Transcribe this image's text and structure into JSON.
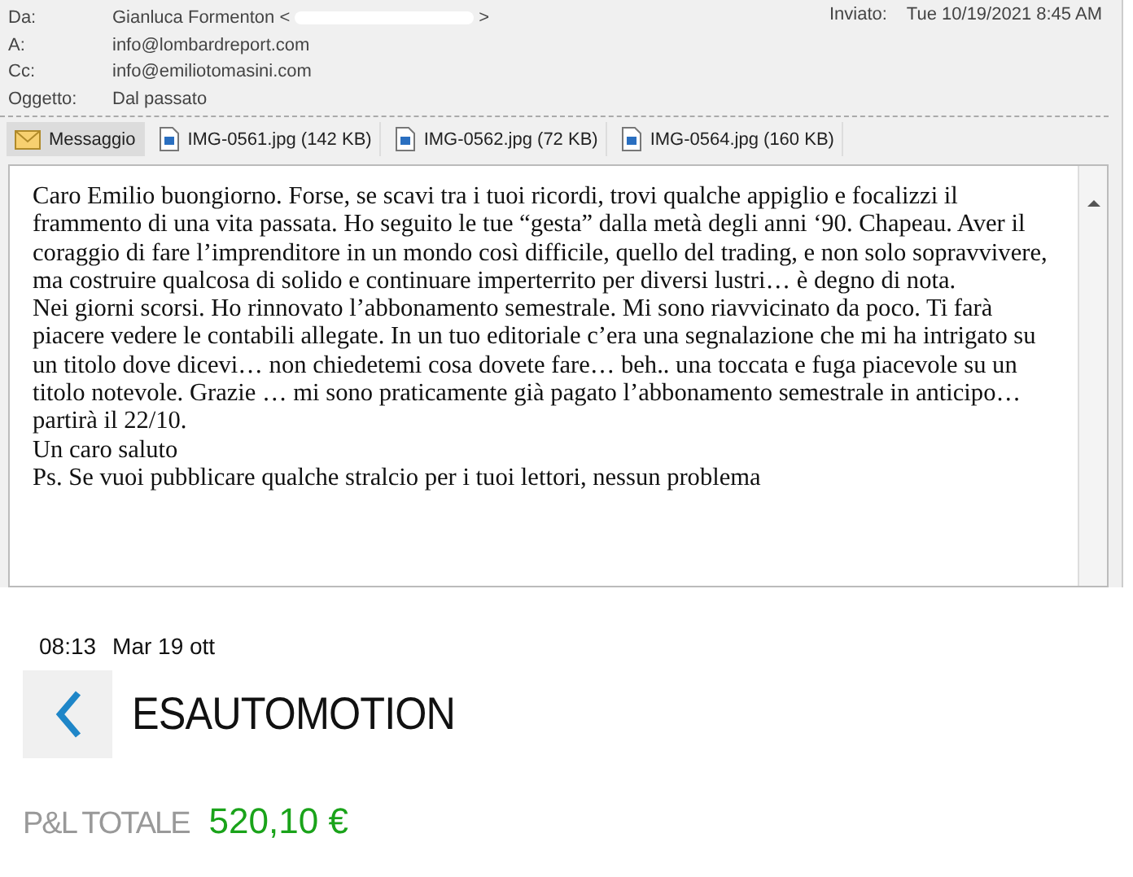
{
  "header": {
    "fields": [
      {
        "label": "Da:",
        "value": "Gianluca Formenton <",
        "value_end": ">"
      },
      {
        "label": "A:",
        "value": "info@lombardreport.com"
      },
      {
        "label": "Cc:",
        "value": "info@emiliotomasini.com"
      },
      {
        "label": "Oggetto:",
        "value": "Dal passato"
      }
    ],
    "sent": {
      "label": "Inviato:",
      "value": "Tue 10/19/2021 8:45 AM"
    }
  },
  "tabs": [
    {
      "kind": "message",
      "label": "Messaggio",
      "selected": true
    },
    {
      "kind": "attachment",
      "label": "IMG-0561.jpg (142 KB)",
      "selected": false
    },
    {
      "kind": "attachment",
      "label": "IMG-0562.jpg (72 KB)",
      "selected": false
    },
    {
      "kind": "attachment",
      "label": "IMG-0564.jpg (160 KB)",
      "selected": false
    }
  ],
  "body": [
    "Caro Emilio buongiorno. Forse, se scavi tra i tuoi ricordi, trovi qualche appiglio e focalizzi il frammento di una vita passata. Ho seguito le tue “gesta” dalla metà degli anni ‘90. Chapeau. Aver il coraggio di fare l’imprenditore in un mondo così difficile, quello del trading,  e non solo sopravvivere, ma costruire qualcosa di solido e continuare imperterrito per diversi lustri… è degno di nota.",
    "Nei giorni scorsi. Ho rinnovato l’abbonamento semestrale. Mi sono riavvicinato da poco. Ti farà piacere vedere le contabili allegate. In un tuo editoriale c’era una segnalazione che mi ha intrigato su un titolo dove dicevi… non chiedetemi cosa dovete fare… beh.. una toccata e fuga piacevole su un titolo notevole. Grazie … mi sono praticamente già pagato l’abbonamento semestrale in anticipo… partirà il 22/10.",
    "Un caro saluto",
    "Ps. Se vuoi pubblicare qualche stralcio per i tuoi lettori, nessun problema"
  ],
  "app": {
    "time": "08:13",
    "date": "Mar 19 ott",
    "title": "ESAUTOMOTION",
    "pl_label": "P&L TOTALE",
    "pl_value": "520,10 €"
  }
}
